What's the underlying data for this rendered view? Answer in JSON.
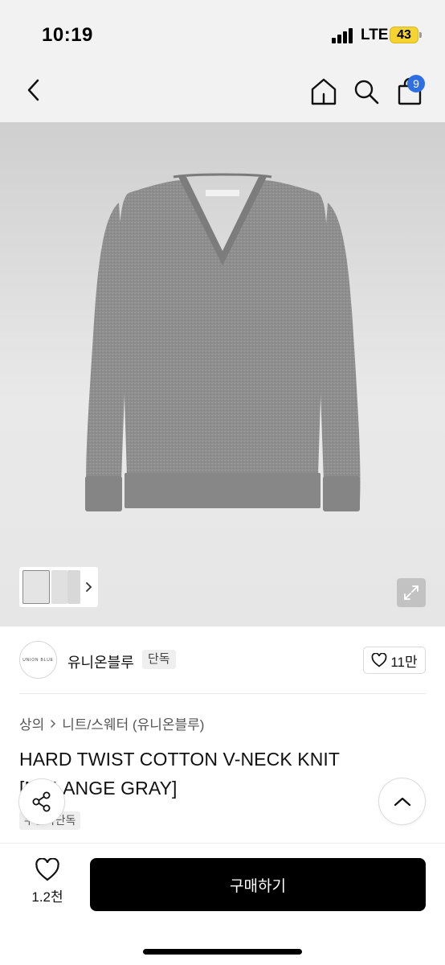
{
  "status_bar": {
    "time": "10:19",
    "network": "LTE",
    "battery": "43"
  },
  "nav": {
    "cart_count": "9"
  },
  "brand": {
    "logo_text": "UNION BLUE",
    "name": "유니온블루",
    "tag": "단독",
    "likes": "11만"
  },
  "breadcrumb": {
    "level1": "상의",
    "level2": "니트/스웨터 (유니온블루)"
  },
  "product": {
    "title": "HARD TWIST COTTON V-NECK KNIT [MELANGE GRAY]",
    "sub_tag": "무신사단독"
  },
  "bottom": {
    "wish_count": "1.2천",
    "buy_label": "구매하기"
  },
  "colors": {
    "badge": "#2f6fe4",
    "sweater": "#8f8f8f",
    "buy_button": "#000000"
  }
}
